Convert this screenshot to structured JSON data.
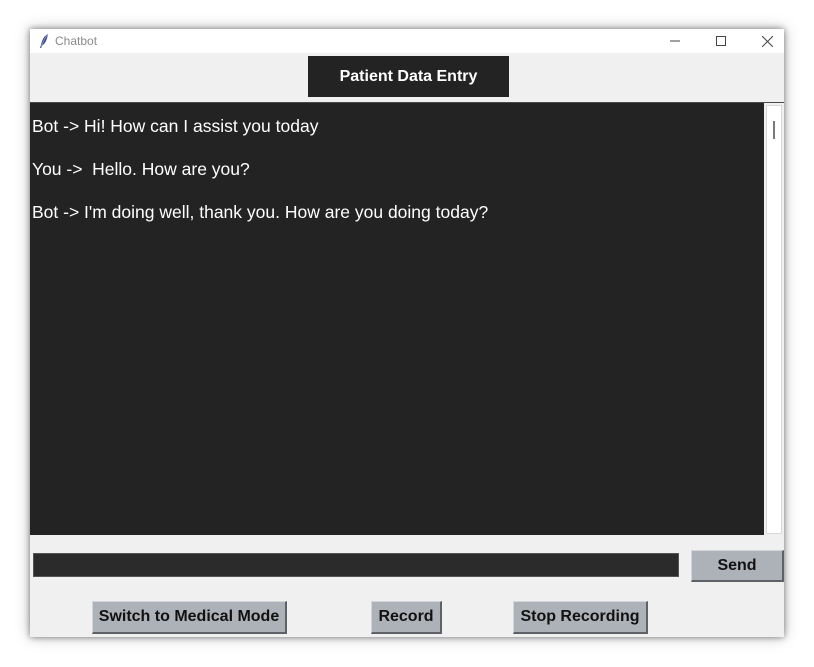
{
  "window": {
    "title": "Chatbot",
    "app_icon": "feather-icon",
    "controls": [
      "minimize-icon",
      "maximize-icon",
      "close-icon"
    ]
  },
  "header": {
    "patient_button_label": "Patient Data Entry"
  },
  "chat": {
    "messages": [
      "Bot -> Hi! How can I assist you today",
      "You ->  Hello. How are you?",
      "Bot -> I'm doing well, thank you. How are you doing today?"
    ]
  },
  "input": {
    "value": "",
    "send_label": "Send"
  },
  "actions": {
    "medical_mode_label": "Switch to Medical Mode",
    "record_label": "Record",
    "stop_recording_label": "Stop Recording"
  },
  "colors": {
    "chat_background": "#232323",
    "button_gray": "#adb1b8",
    "window_background": "#f0f0f0"
  }
}
